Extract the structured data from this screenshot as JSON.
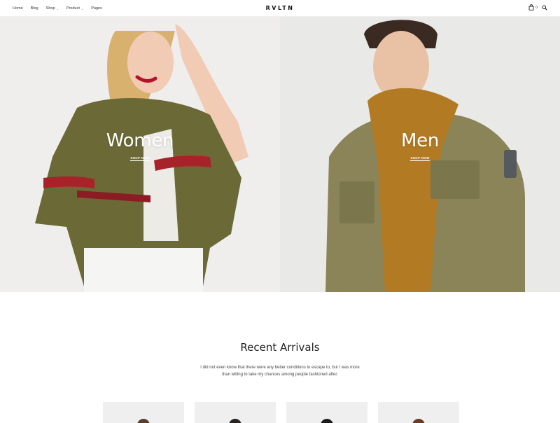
{
  "header": {
    "nav": [
      {
        "label": "Home"
      },
      {
        "label": "Blog"
      },
      {
        "label": "Shop"
      },
      {
        "label": "Product"
      },
      {
        "label": "Pages"
      }
    ],
    "logo": "RVLTN",
    "cart_count": "0",
    "icons": [
      "shopping-bag-icon",
      "search-icon"
    ]
  },
  "hero": {
    "women": {
      "title": "Women",
      "cta": "SHOP NOW"
    },
    "men": {
      "title": "Men",
      "cta": "SHOP NOW"
    }
  },
  "recent": {
    "title": "Recent Arrivals",
    "description": "I did not even know that there were any better conditions to escape to, but I was more than willing to take my chances among people fashioned after."
  },
  "colors": {
    "olive_jacket": "#6b6a36",
    "men_jacket": "#8a8458",
    "hoodie": "#b27a23",
    "hero_bg": "#efeeed"
  }
}
